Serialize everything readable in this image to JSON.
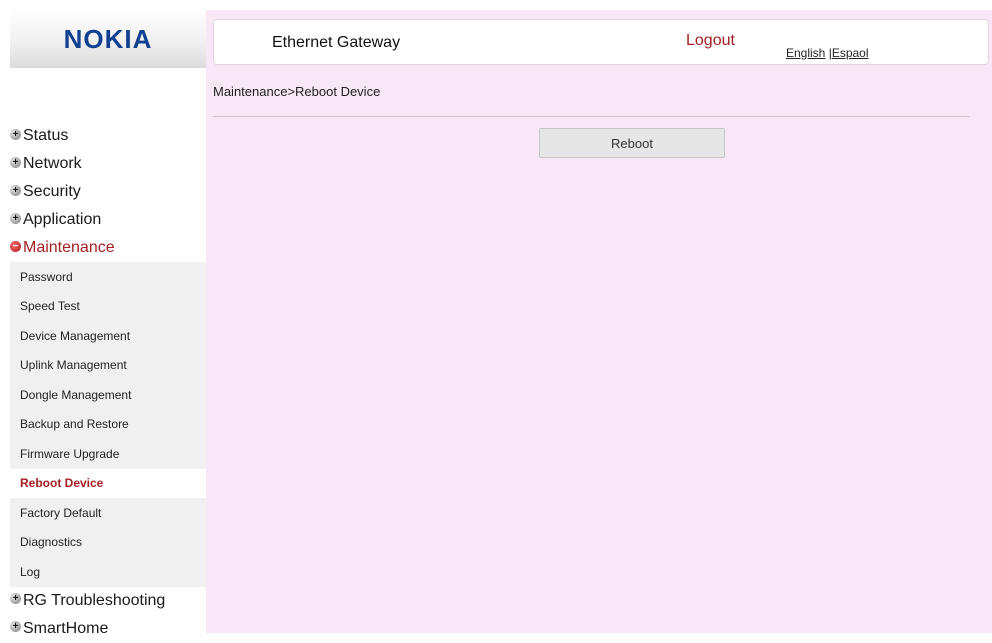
{
  "brand": {
    "logo_text": "NOKIA"
  },
  "header": {
    "title": "Ethernet Gateway",
    "logout": "Logout",
    "lang_english": "English",
    "lang_separator": " |",
    "lang_espanol": "Espaol"
  },
  "breadcrumb": "Maintenance>Reboot Device",
  "actions": {
    "reboot_label": "Reboot"
  },
  "sidebar": {
    "categories_top": [
      {
        "label": "Status"
      },
      {
        "label": "Network"
      },
      {
        "label": "Security"
      },
      {
        "label": "Application"
      }
    ],
    "open_category": {
      "label": "Maintenance"
    },
    "maintenance_items": [
      {
        "label": "Password"
      },
      {
        "label": "Speed Test"
      },
      {
        "label": "Device Management"
      },
      {
        "label": "Uplink Management"
      },
      {
        "label": "Dongle Management"
      },
      {
        "label": "Backup and Restore"
      },
      {
        "label": "Firmware Upgrade"
      },
      {
        "label": "Reboot Device"
      },
      {
        "label": "Factory Default"
      },
      {
        "label": "Diagnostics"
      },
      {
        "label": "Log"
      }
    ],
    "categories_bottom": [
      {
        "label": "RG Troubleshooting"
      },
      {
        "label": "SmartHome"
      }
    ],
    "active_item": "Reboot Device"
  },
  "colors": {
    "accent_red": "#a41e22",
    "brand_blue": "#124191",
    "main_bg": "#f8e8f6",
    "submenu_bg": "#f0f0f0"
  }
}
